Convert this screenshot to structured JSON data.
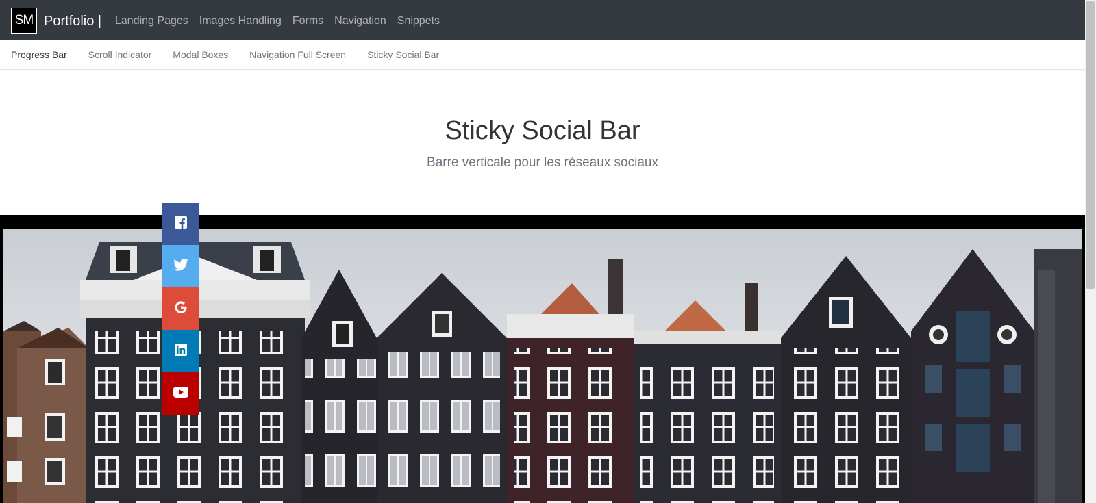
{
  "brand": {
    "logo_text": "SM",
    "title": "Portfolio |"
  },
  "main_nav": [
    {
      "label": "Landing Pages"
    },
    {
      "label": "Images Handling"
    },
    {
      "label": "Forms"
    },
    {
      "label": "Navigation"
    },
    {
      "label": "Snippets"
    }
  ],
  "sub_nav": [
    {
      "label": "Progress Bar",
      "active": true
    },
    {
      "label": "Scroll Indicator"
    },
    {
      "label": "Modal Boxes"
    },
    {
      "label": "Navigation Full Screen"
    },
    {
      "label": "Sticky Social Bar"
    }
  ],
  "hero": {
    "title": "Sticky Social Bar",
    "subtitle": "Barre verticale pour les réseaux sociaux"
  },
  "social": [
    {
      "icon": "facebook-icon",
      "color": "#3b5998"
    },
    {
      "icon": "twitter-icon",
      "color": "#55acee"
    },
    {
      "icon": "google-icon",
      "color": "#dd4b39"
    },
    {
      "icon": "linkedin-icon",
      "color": "#007bb5"
    },
    {
      "icon": "youtube-icon",
      "color": "#bb0000"
    }
  ],
  "colors": {
    "navbar": "#343a40",
    "band": "#000000"
  }
}
